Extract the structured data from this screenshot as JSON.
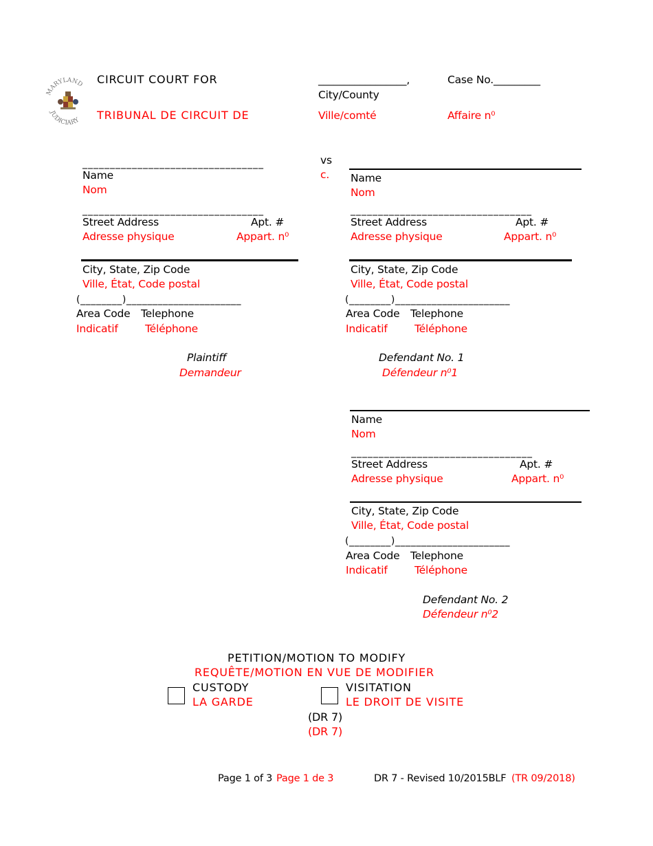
{
  "header": {
    "logo_icon": "maryland-judiciary-seal-icon",
    "court_en": "CIRCUIT COURT FOR",
    "court_fr": "TRIBUNAL DE CIRCUIT DE",
    "city_blank": "_________________,",
    "city_label_en": "City/County",
    "city_label_fr": "Ville/comté",
    "case_en": "Case No._________",
    "case_fr": "Affaire n⁰"
  },
  "vs": {
    "en": "vs",
    "fr": "c."
  },
  "plaintiff": {
    "name_blank": "_________________________________",
    "name_en": "Name",
    "name_fr": "Nom",
    "street_blank": "_________________________________",
    "street_en": "Street Address",
    "street_fr": "Adresse physique",
    "apt_en": "Apt. #",
    "apt_fr": "Appart. n⁰",
    "city_en": "City, State, Zip Code",
    "city_fr": "Ville, État, Code postal",
    "phone_blank": "(________)______________________",
    "area_en": "Area Code",
    "area_fr": "Indicatif",
    "tel_en": "Telephone",
    "tel_fr": "Téléphone",
    "role_en": "Plaintiff",
    "role_fr": "Demandeur"
  },
  "defendant1": {
    "name_en": "Name",
    "name_fr": "Nom",
    "street_blank": "_________________________________",
    "street_en": "Street Address",
    "street_fr": "Adresse physique",
    "apt_en": "Apt. #",
    "apt_fr": "Appart. n⁰",
    "city_en": "City, State, Zip Code",
    "city_fr": "Ville, État, Code postal",
    "phone_blank": "(________)______________________",
    "area_en": "Area Code",
    "area_fr": "Indicatif",
    "tel_en": "Telephone",
    "tel_fr": "Téléphone",
    "role_en": "Defendant No. 1",
    "role_fr": "Défendeur n⁰1"
  },
  "defendant2": {
    "name_en": "Name",
    "name_fr": "Nom",
    "street_blank": "_________________________________",
    "street_en": "Street Address",
    "street_fr": "Adresse physique",
    "apt_en": "Apt. #",
    "apt_fr": "Appart. n⁰",
    "city_en": "City, State, Zip Code",
    "city_fr": "Ville, État, Code postal",
    "phone_blank": "(________)______________________",
    "area_en": "Area Code",
    "area_fr": "Indicatif",
    "tel_en": "Telephone",
    "tel_fr": "Téléphone",
    "role_en": "Defendant No. 2",
    "role_fr": "Défendeur n⁰2"
  },
  "title": {
    "en": "PETITION/MOTION TO MODIFY",
    "fr": "REQUÊTE/MOTION EN VUE DE MODIFIER",
    "custody_en": "CUSTODY",
    "custody_fr": "LA GARDE",
    "custody_checked": false,
    "visitation_en": "VISITATION",
    "visitation_fr": "LE DROIT DE VISITE",
    "visitation_checked": false,
    "form_en": "(DR 7)",
    "form_fr": "(DR 7)"
  },
  "footer": {
    "page_en": "Page 1 of 3",
    "page_fr": "Page 1 de 3",
    "form_id": "DR 7 - Revised 10/2015BLF",
    "translation_id": "(TR 09/2018)"
  },
  "colors": {
    "english": "#000000",
    "french": "#ff0000"
  }
}
